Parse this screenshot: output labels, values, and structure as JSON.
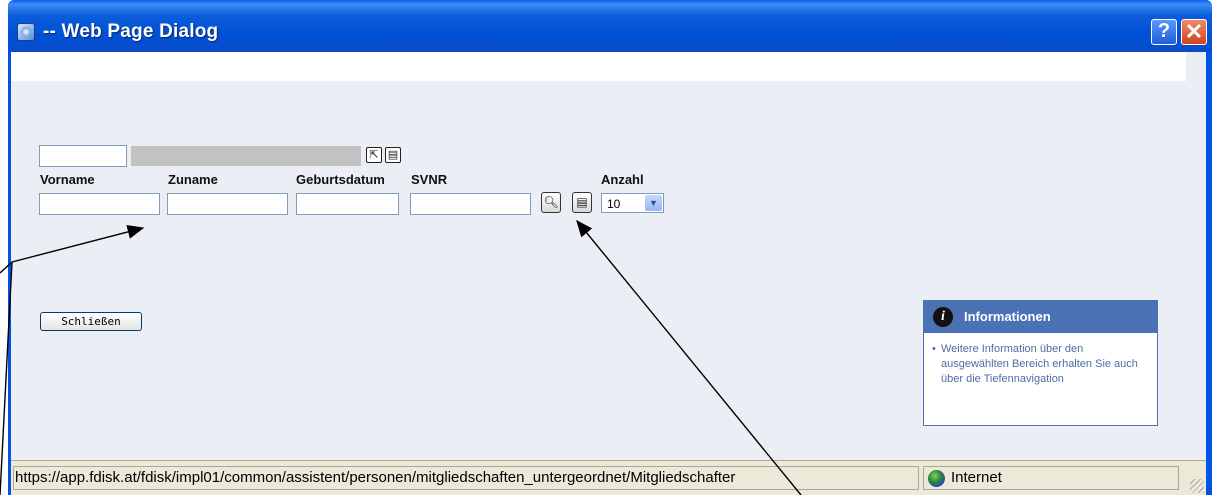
{
  "window": {
    "title": "-- Web Page Dialog",
    "help_symbol": "?",
    "close_symbol": "✕"
  },
  "form": {
    "labels": {
      "vorname": "Vorname",
      "zuname": "Zuname",
      "geburtsdatum": "Geburtsdatum",
      "svnr": "SVNR",
      "anzahl": "Anzahl"
    },
    "fields": {
      "code": "",
      "vorname": "",
      "zuname": "",
      "geburtsdatum": "",
      "svnr": ""
    },
    "anzahl_selected": "10",
    "close_button": "Schließen"
  },
  "info_box": {
    "icon": "i",
    "title": "Informationen",
    "text": "Weitere Information über den ausgewählten Bereich erhalten Sie auch über die Tiefennavigation"
  },
  "status_bar": {
    "url": "https://app.fdisk.at/fdisk/impl01/common/assistent/personen/mitgliedschaften_untergeordnet/Mitgliedschafter",
    "zone": "Internet"
  },
  "icons": {
    "title": "ie-page-icon",
    "pointer": "cursor-select-icon",
    "list": "list-icon",
    "search": "magnifier-icon",
    "dropdown": "chevron-down-icon",
    "zone": "globe-icon"
  }
}
